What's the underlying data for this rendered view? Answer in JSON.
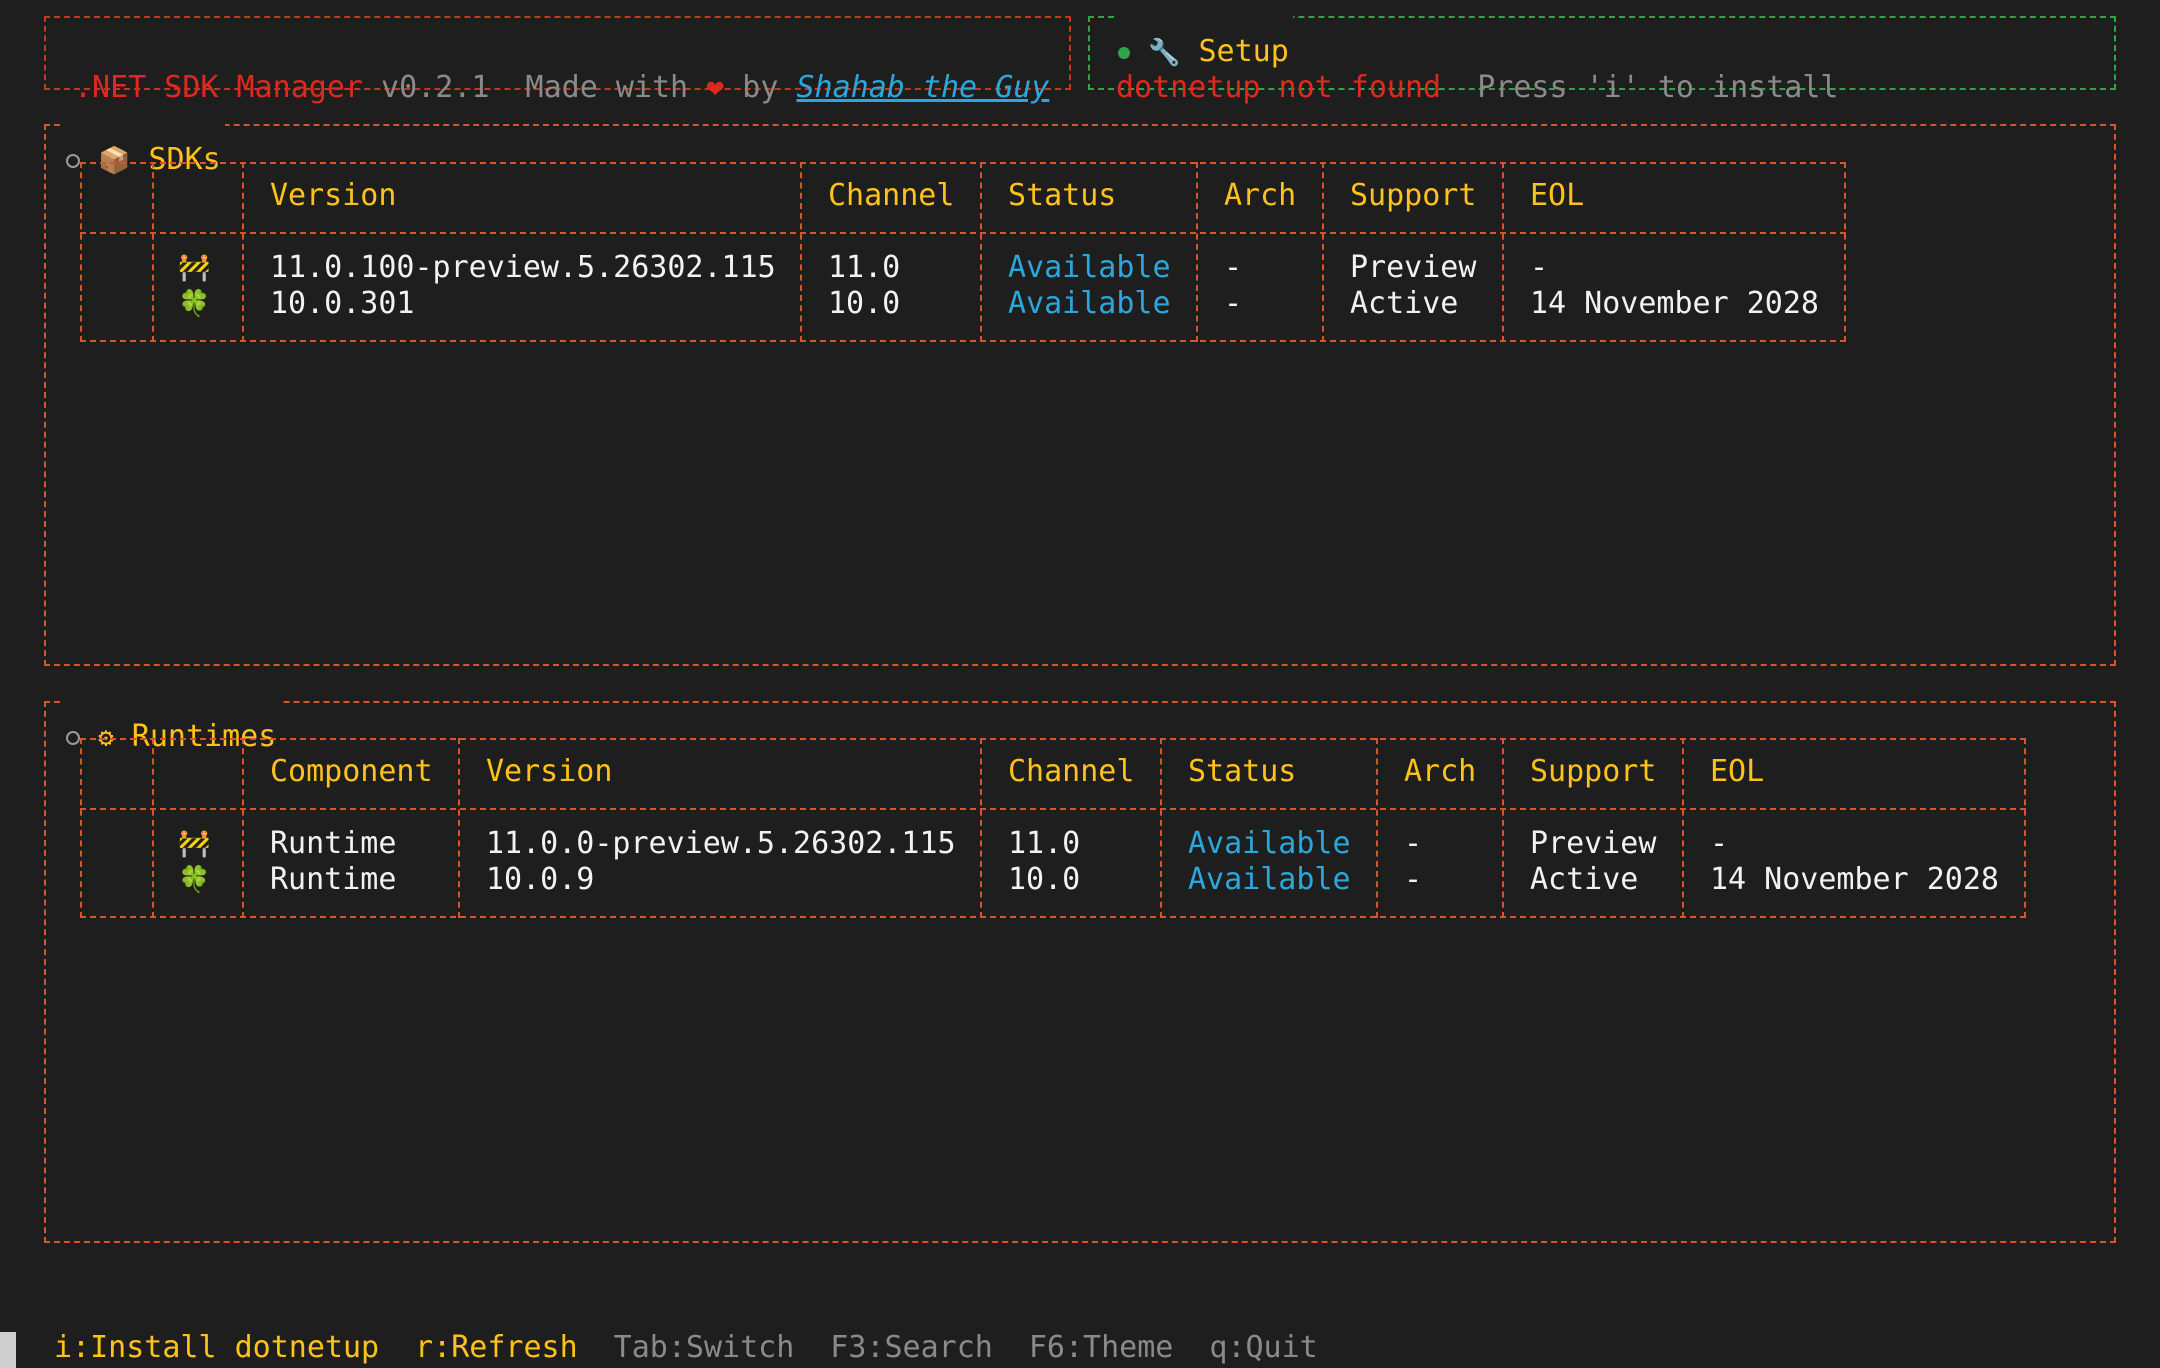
{
  "header": {
    "app_name": ".NET SDK Manager",
    "version": "v0.2.1",
    "made_with": "Made with",
    "heart": "❤",
    "by": "by",
    "author": "Shahab the Guy"
  },
  "setup": {
    "title": "Setup",
    "icon": "wrench-icon",
    "glyph": "🔧",
    "status": "dotnetup not found",
    "hint": "Press 'i' to install"
  },
  "sdks": {
    "title": "SDKs",
    "glyph": "📦",
    "columns": [
      "Version",
      "Channel",
      "Status",
      "Arch",
      "Support",
      "EOL"
    ],
    "rows": [
      {
        "icon": "🚧",
        "version": "11.0.100-preview.5.26302.115",
        "channel": "11.0",
        "status": "Available",
        "arch": "-",
        "support": "Preview",
        "eol": "-"
      },
      {
        "icon": "🍀",
        "version": "10.0.301",
        "channel": "10.0",
        "status": "Available",
        "arch": "-",
        "support": "Active",
        "eol": "14 November 2028"
      }
    ]
  },
  "runtimes": {
    "title": "Runtimes",
    "glyph": "⚙",
    "columns": [
      "Component",
      "Version",
      "Channel",
      "Status",
      "Arch",
      "Support",
      "EOL"
    ],
    "rows": [
      {
        "icon": "🚧",
        "component": "Runtime",
        "version": "11.0.0-preview.5.26302.115",
        "channel": "11.0",
        "status": "Available",
        "arch": "-",
        "support": "Preview",
        "eol": "-"
      },
      {
        "icon": "🍀",
        "component": "Runtime",
        "version": "10.0.9",
        "channel": "10.0",
        "status": "Available",
        "arch": "-",
        "support": "Active",
        "eol": "14 November 2028"
      }
    ]
  },
  "footer": {
    "install": "i:Install dotnetup",
    "refresh": "r:Refresh",
    "switch": "Tab:Switch",
    "search": "F3:Search",
    "theme": "F6:Theme",
    "quit": "q:Quit"
  },
  "colors": {
    "background": "#1e1e1e",
    "accent_yellow": "#ffc21a",
    "border_red": "#c8361d",
    "border_green": "#2fa44a",
    "border_orange": "#d9532b",
    "status_blue": "#2aa7dc",
    "error_red": "#e0281e"
  }
}
